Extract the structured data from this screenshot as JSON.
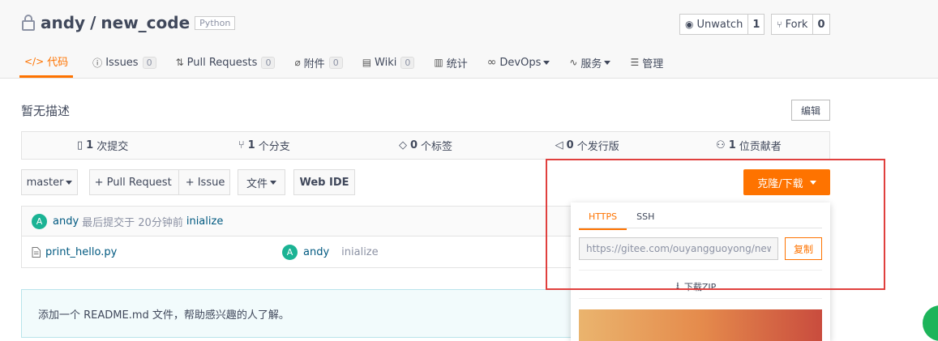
{
  "repo": {
    "owner": "andy",
    "separator": "/",
    "name": "new_code",
    "language": "Python"
  },
  "actions": {
    "unwatch_label": "Unwatch",
    "unwatch_count": "1",
    "fork_label": "Fork",
    "fork_count": "0"
  },
  "tabs": [
    {
      "label": "代码",
      "icon": "code-icon"
    },
    {
      "label": "Issues",
      "count": "0",
      "icon": "issue-icon"
    },
    {
      "label": "Pull Requests",
      "count": "0",
      "icon": "pull-request-icon"
    },
    {
      "label": "附件",
      "count": "0",
      "icon": "attachment-icon"
    },
    {
      "label": "Wiki",
      "count": "0",
      "icon": "wiki-icon"
    },
    {
      "label": "统计",
      "icon": "stats-icon"
    },
    {
      "label": "DevOps",
      "icon": "devops-icon"
    },
    {
      "label": "服务",
      "icon": "service-icon"
    },
    {
      "label": "管理",
      "icon": "manage-icon"
    }
  ],
  "description": "暂无描述",
  "edit_label": "编辑",
  "stats": {
    "commits_count": "1",
    "commits_label": "次提交",
    "branches_count": "1",
    "branches_label": "个分支",
    "tags_count": "0",
    "tags_label": "个标签",
    "releases_count": "0",
    "releases_label": "个发行版",
    "contributors_count": "1",
    "contributors_label": "位贡献者"
  },
  "toolbar": {
    "branch": "master",
    "pull_request": "+ Pull Request",
    "issue": "+ Issue",
    "file": "文件",
    "web_ide": "Web IDE",
    "clone": "克隆/下载"
  },
  "commit": {
    "avatar_letter": "A",
    "author": "andy",
    "text": "最后提交于 20分钟前",
    "message": "inialize"
  },
  "files": [
    {
      "name": "print_hello.py",
      "avatar_letter": "A",
      "author": "andy",
      "message": "inialize"
    }
  ],
  "readme_hint": "添加一个 README.md 文件，帮助感兴趣的人了解。",
  "clone_panel": {
    "tab_https": "HTTPS",
    "tab_ssh": "SSH",
    "url": "https://gitee.com/ouyangguoyong/new_code.git",
    "copy": "复制",
    "download_zip": "下载ZIP"
  },
  "colors": {
    "accent": "#fe7300",
    "highlight": "#e0403e",
    "avatar": "#1bb394"
  }
}
